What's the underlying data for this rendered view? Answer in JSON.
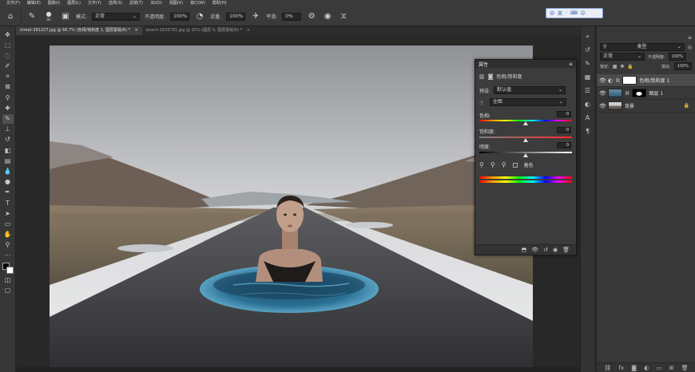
{
  "menu": [
    "文件(F)",
    "编辑(E)",
    "图像(I)",
    "图层(L)",
    "文字(Y)",
    "选择(S)",
    "滤镜(T)",
    "3D(D)",
    "视图(V)",
    "窗口(W)",
    "帮助(H)"
  ],
  "options": {
    "size_value": "86",
    "mode_label": "模式:",
    "mode_value": "正常",
    "opacity_label": "不透明度:",
    "opacity_value": "100%",
    "flow_label": "流量:",
    "flow_value": "100%",
    "smooth_label": "平滑:",
    "smooth_value": "0%"
  },
  "ime": {
    "items": [
      "中",
      "英",
      "·",
      "⌨",
      "☺"
    ]
  },
  "tabs": [
    {
      "label": "street-381227.jpg @ 66.7% (色相/饱和度 1, 图层蒙版/8) *",
      "active": true
    },
    {
      "label": "beach-1835781.jpg @ 25% (图层 0, 图层蒙版/8) *",
      "active": false
    }
  ],
  "properties": {
    "title": "属性",
    "adjustment_name": "色相/饱和度",
    "preset_label": "预设:",
    "preset_value": "默认值",
    "channel_value": "全图",
    "hue_label": "色相:",
    "hue_value": "0",
    "hue_position": 0.5,
    "saturation_label": "饱和度:",
    "saturation_value": "0",
    "saturation_position": 0.5,
    "lightness_label": "明度:",
    "lightness_value": "0",
    "lightness_position": 0.5,
    "colorize_label": "着色"
  },
  "layers_panel": {
    "filter_value": "类型",
    "blend_value": "正常",
    "opacity_label": "不透明度:",
    "opacity_value": "100%",
    "lock_label": "锁定:",
    "fill_label": "填充:",
    "fill_value": "100%",
    "layers": [
      {
        "name": "色相/饱和度 1",
        "selected": true
      },
      {
        "name": "图层 1",
        "selected": false
      },
      {
        "name": "背景",
        "selected": false,
        "locked": true
      }
    ]
  },
  "colors": {
    "foreground": "#000000",
    "background": "#ffffff",
    "panel": "#383838",
    "selected_layer": "#4b4b4b"
  }
}
